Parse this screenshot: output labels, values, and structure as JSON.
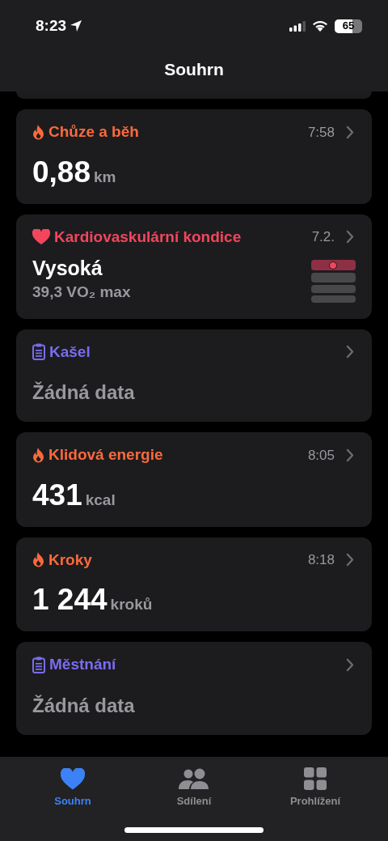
{
  "status_bar": {
    "time": "8:23",
    "battery": "65"
  },
  "nav": {
    "title": "Souhrn"
  },
  "cards": [
    {
      "kind": "activity",
      "color": "#fa6a3c",
      "title": "Chůze a běh",
      "time": "7:58",
      "value": "0,88",
      "unit": "km"
    },
    {
      "kind": "cardio",
      "color": "#f2465d",
      "title": "Kardiovaskulární kondice",
      "time": "7.2.",
      "value": "Vysoká",
      "detail": "39,3 VO₂ max",
      "meter": [
        {
          "selected": true
        },
        {
          "selected": false
        },
        {
          "selected": false
        },
        {
          "selected": false
        }
      ]
    },
    {
      "kind": "symptom",
      "color": "#7a6cf0",
      "title": "Kašel",
      "value": "Žádná data"
    },
    {
      "kind": "activity",
      "color": "#fa6a3c",
      "title": "Klidová energie",
      "time": "8:05",
      "value": "431",
      "unit": "kcal"
    },
    {
      "kind": "activity",
      "color": "#fa6a3c",
      "title": "Kroky",
      "time": "8:18",
      "value": "1 244",
      "unit": "kroků"
    },
    {
      "kind": "symptom",
      "color": "#7a6cf0",
      "title": "Městnání",
      "value": "Žádná data"
    }
  ],
  "tabs": [
    {
      "label": "Souhrn",
      "selected": true
    },
    {
      "label": "Sdílení",
      "selected": false
    },
    {
      "label": "Prohlížení",
      "selected": false
    }
  ]
}
